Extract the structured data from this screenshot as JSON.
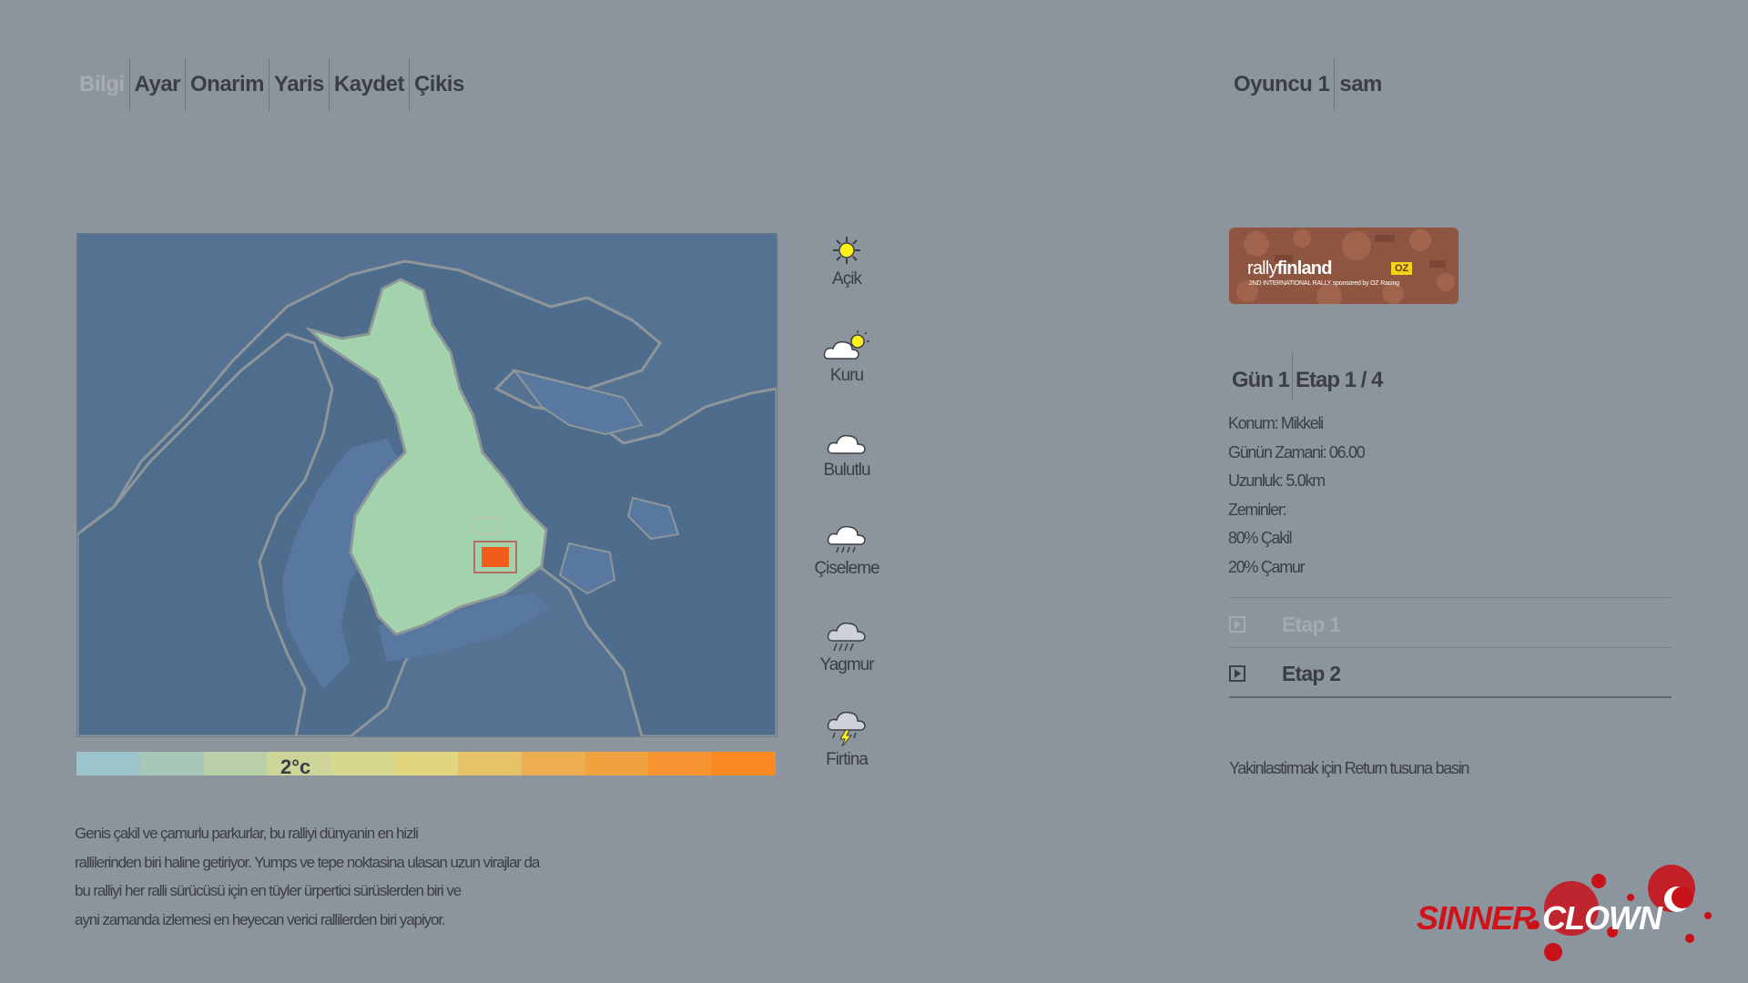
{
  "menu": {
    "items": [
      {
        "label": "Bilgi",
        "active": false
      },
      {
        "label": "Ayar",
        "active": true
      },
      {
        "label": "Onarim",
        "active": true
      },
      {
        "label": "Yaris",
        "active": true
      },
      {
        "label": "Kaydet",
        "active": true
      },
      {
        "label": "Çikis",
        "active": true
      }
    ]
  },
  "player": {
    "label": "Oyuncu 1",
    "name": "sam"
  },
  "map": {
    "temperature": "2°c",
    "temp_scale_colors": [
      "#9dc3cc",
      "#a6c8b8",
      "#b9cfa7",
      "#cdd598",
      "#d6d98d",
      "#e1d67f",
      "#e6c367",
      "#ecae50",
      "#f0a23f",
      "#f59431",
      "#f98920"
    ]
  },
  "weather": [
    {
      "label": "Açik",
      "icon": "sun-icon"
    },
    {
      "label": "Kuru",
      "icon": "partly-cloudy-icon"
    },
    {
      "label": "Bulutlu",
      "icon": "cloud-icon"
    },
    {
      "label": "Çiseleme",
      "icon": "drizzle-icon"
    },
    {
      "label": "Yagmur",
      "icon": "rain-icon"
    },
    {
      "label": "Firtina",
      "icon": "storm-icon"
    }
  ],
  "description": {
    "lines": [
      "Genis çakil ve çamurlu parkurlar, bu ralliyi dünyanin en hizli",
      "rallilerinden biri haline getiriyor. Yumps ve tepe noktasina ulasan uzun virajlar da",
      "bu ralliyi her ralli sürücüsü için en tüyler ürpertici sürüslerden biri ve",
      "ayni zamanda izlemesi en heyecan verici rallilerden biri yapiyor."
    ]
  },
  "banner": {
    "brand_light": "rally",
    "brand_bold": "finland",
    "badge": "OZ",
    "subtitle": "2ND INTERNATIONAL RALLY sponsored by OZ Racing"
  },
  "stage": {
    "day": "Gün 1",
    "stage": "Etap 1 / 4",
    "info": [
      "Konum: Mikkeli",
      "Günün Zamani: 06.00",
      "Uzunluk: 5.0km",
      "Zeminler:",
      "80% Çakil",
      "20% Çamur"
    ],
    "list": [
      {
        "label": "Etap 1",
        "enabled": false
      },
      {
        "label": "Etap 2",
        "enabled": true
      }
    ]
  },
  "hint": "Yakinlastirmak için Return tusuna basin",
  "logo": {
    "part1": "SINNER",
    "part2": "CLOWN"
  },
  "colors": {
    "background": "#8c949e",
    "land_finland": "#a2d3ad",
    "sea": "#53708f",
    "marker": "#f25c1a"
  }
}
